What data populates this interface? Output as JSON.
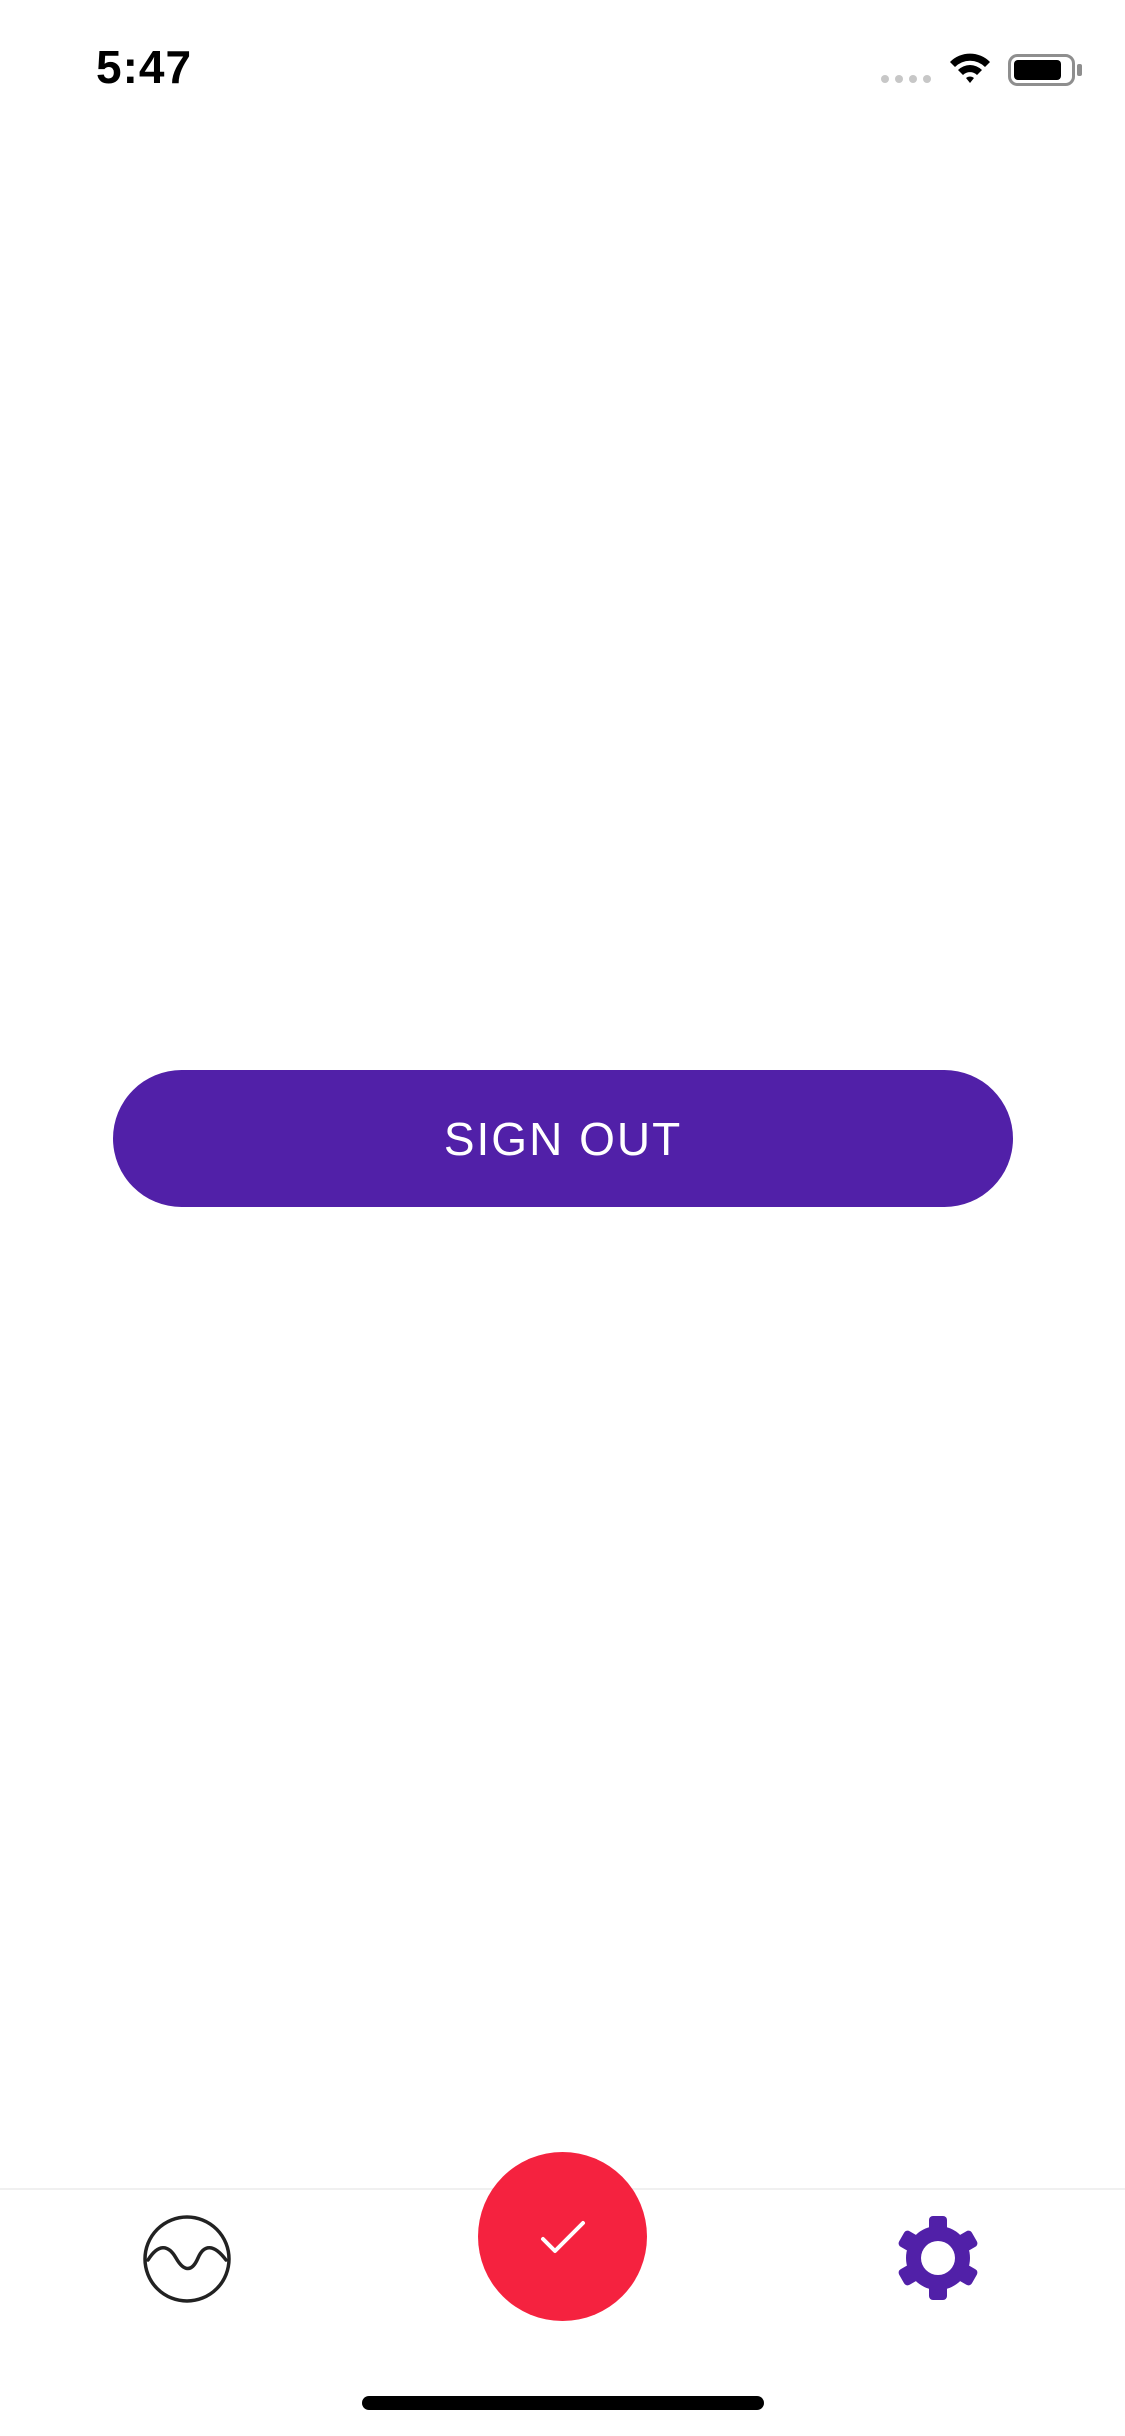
{
  "status_bar": {
    "time": "5:47",
    "signal_icon": "cellular-signal-icon",
    "wifi_icon": "wifi-icon",
    "battery_icon": "battery-icon"
  },
  "main": {
    "sign_out_label": "SIGN OUT"
  },
  "tab_bar": {
    "left_icon": "wave-circle-icon",
    "center_icon": "checkmark-icon",
    "right_icon": "gear-icon"
  },
  "colors": {
    "primary_purple": "#5120A8",
    "accent_red": "#F5223F",
    "icon_dark": "#222222",
    "background": "#FFFFFF"
  }
}
